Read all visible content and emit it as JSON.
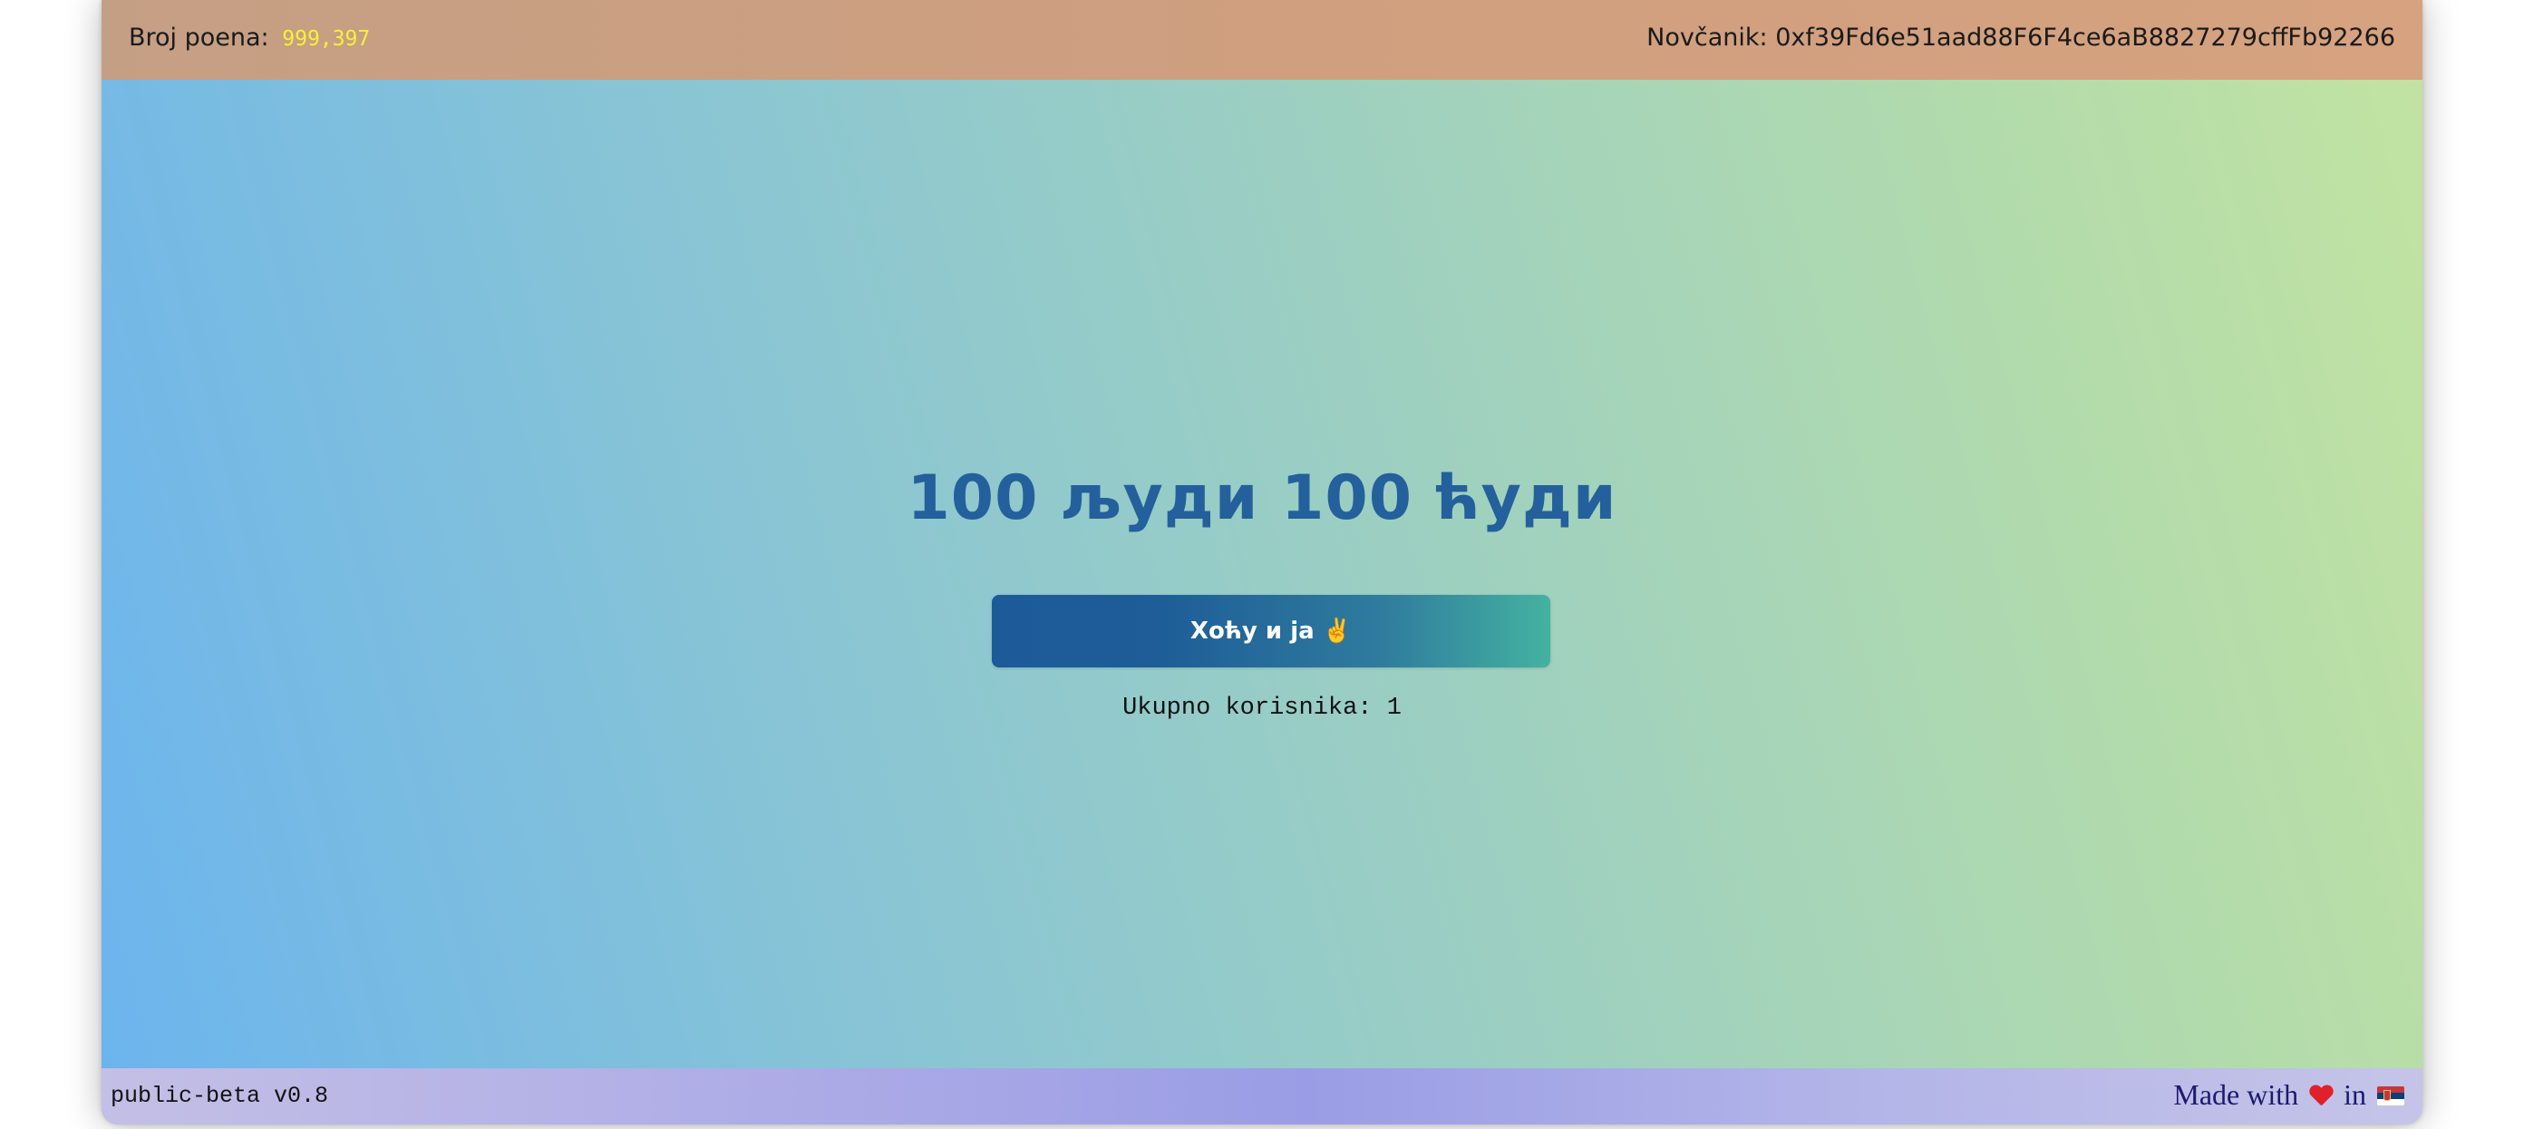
{
  "header": {
    "points_label": "Broj poena:",
    "points_value": "999,397",
    "wallet_label": "Novčanik:",
    "wallet_address": "0xf39Fd6e51aad88F6F4ce6aB8827279cffFb92266"
  },
  "main": {
    "title": "100 људи 100 ћуди",
    "join_button_label": "Хоћу и ја ✌️",
    "user_count_label": "Ukupno korisnika:",
    "user_count_value": "1"
  },
  "footer": {
    "version": "public-beta v0.8",
    "made_with_prefix": "Made with",
    "made_with_in": "in",
    "heart_icon": "heart-icon",
    "flag_icon": "serbia-flag-icon"
  },
  "colors": {
    "title": "#23609c",
    "points_value": "#f7f233",
    "footer_text": "#1b1a6e"
  }
}
